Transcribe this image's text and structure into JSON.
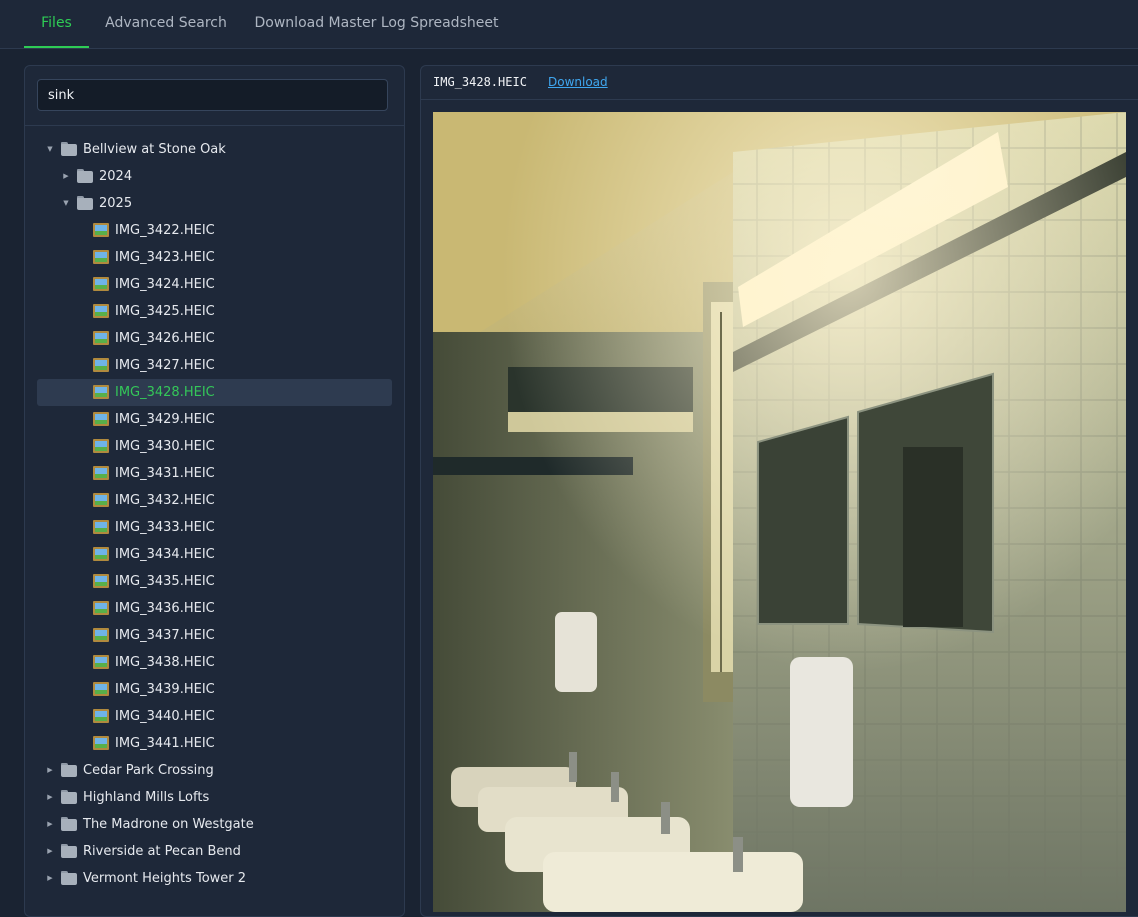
{
  "tabs": [
    {
      "label": "Files",
      "active": true
    },
    {
      "label": "Advanced Search",
      "active": false
    },
    {
      "label": "Download Master Log Spreadsheet",
      "active": false
    }
  ],
  "search": {
    "value": "sink"
  },
  "tree": {
    "root": {
      "label": "Bellview at Stone Oak",
      "expanded": true
    },
    "years": [
      {
        "label": "2024",
        "expanded": false
      },
      {
        "label": "2025",
        "expanded": true
      }
    ],
    "files": [
      "IMG_3422.HEIC",
      "IMG_3423.HEIC",
      "IMG_3424.HEIC",
      "IMG_3425.HEIC",
      "IMG_3426.HEIC",
      "IMG_3427.HEIC",
      "IMG_3428.HEIC",
      "IMG_3429.HEIC",
      "IMG_3430.HEIC",
      "IMG_3431.HEIC",
      "IMG_3432.HEIC",
      "IMG_3433.HEIC",
      "IMG_3434.HEIC",
      "IMG_3435.HEIC",
      "IMG_3436.HEIC",
      "IMG_3437.HEIC",
      "IMG_3438.HEIC",
      "IMG_3439.HEIC",
      "IMG_3440.HEIC",
      "IMG_3441.HEIC"
    ],
    "selected_file": "IMG_3428.HEIC",
    "other_folders": [
      "Cedar Park Crossing",
      "Highland Mills Lofts",
      "The Madrone on Westgate",
      "Riverside at Pecan Bend",
      "Vermont Heights Tower 2"
    ]
  },
  "viewer": {
    "filename": "IMG_3428.HEIC",
    "download_label": "Download"
  },
  "colors": {
    "accent": "#2ecc55",
    "link": "#3fa7f0",
    "background": "#1a2332",
    "panel": "#1e2839"
  },
  "icons": {
    "folder": "folder-icon",
    "file": "image-file-icon",
    "expanded": "caret-down-icon",
    "collapsed": "caret-right-icon"
  }
}
